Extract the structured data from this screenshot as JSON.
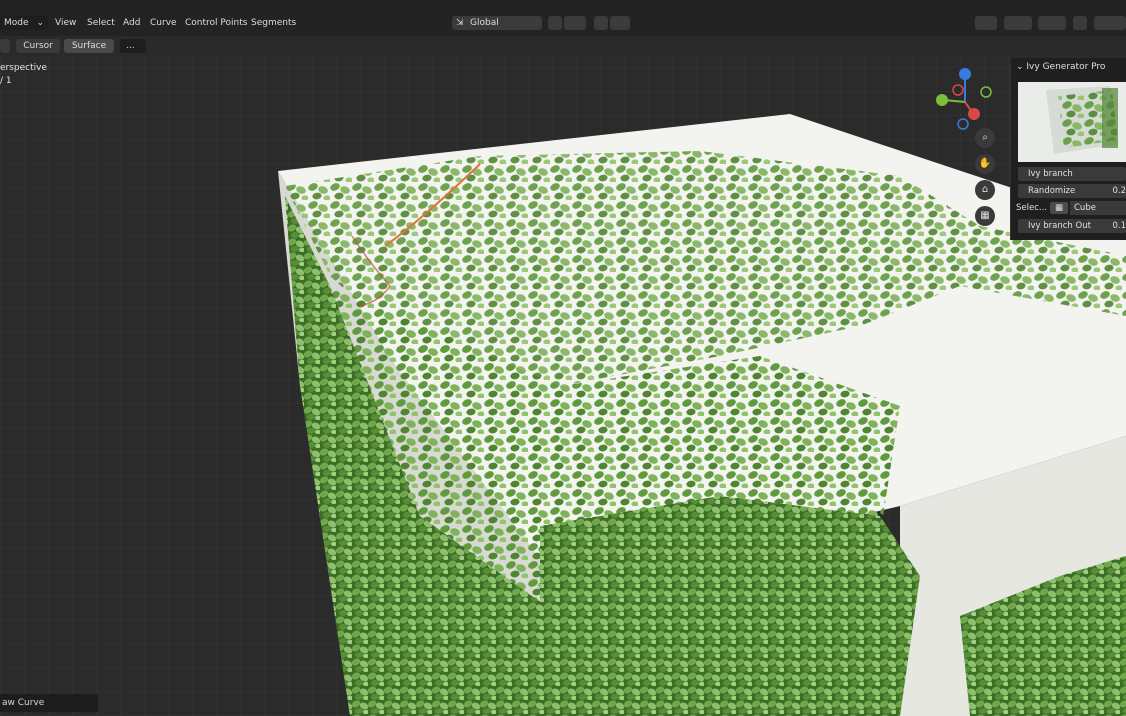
{
  "header": {
    "mode_label": "Mode",
    "menu": [
      "View",
      "Select",
      "Add",
      "Curve",
      "Control Points",
      "Segments"
    ],
    "transform_orientation": "Global"
  },
  "toolbar2": {
    "cursor_label": "Cursor",
    "surface_label": "Surface",
    "extra_label": "..."
  },
  "viewport": {
    "view_name": "erspective",
    "collection": "/ 1",
    "operator_panel": "aw Curve"
  },
  "ivy_panel": {
    "title": "Ivy Generator Pro",
    "rows": [
      {
        "label": "Ivy branch",
        "value": ""
      },
      {
        "label": "Randomize",
        "value": "0.2"
      },
      {
        "label": "Selec...",
        "value": "Cube"
      },
      {
        "label": "Ivy branch Out",
        "value": "0.1"
      }
    ]
  },
  "colors": {
    "gizmo_x": "#d94848",
    "gizmo_y": "#7bbf3a",
    "gizmo_z": "#3a7be0",
    "ivy_green": "#5f9a3c",
    "cube_white": "#f2f2ef"
  }
}
